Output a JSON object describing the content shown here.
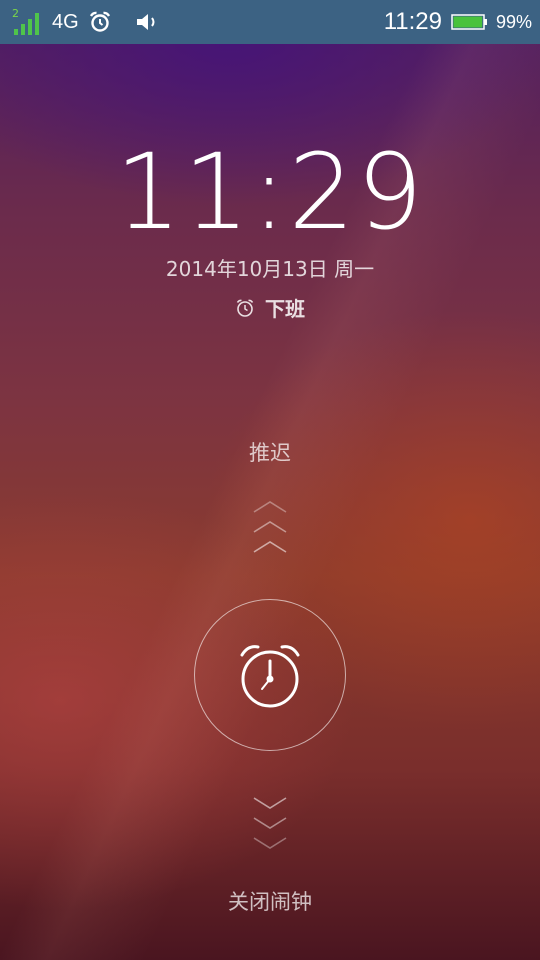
{
  "status_bar": {
    "sim_slot": "2",
    "network_type": "4G",
    "time": "11:29",
    "battery_percent": "99%",
    "battery_level": 0.99,
    "icons": [
      "signal-icon",
      "alarm-icon",
      "volume-icon",
      "battery-icon"
    ],
    "background_color": "#3c6283",
    "signal_color": "#4fc44a",
    "battery_color": "#49c23c"
  },
  "lock_screen": {
    "time": "11:29",
    "date": "2014年10月13日 周一",
    "alarm_name": "下班",
    "snooze_label": "推迟",
    "dismiss_label": "关闭闹钟",
    "handle_icon": "alarm-clock-icon"
  }
}
